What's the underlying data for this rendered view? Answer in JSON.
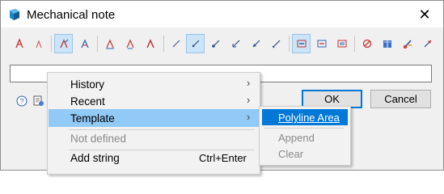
{
  "window": {
    "title": "Mechanical note",
    "close_glyph": "✕",
    "accent": "#0078d7"
  },
  "toolbar": {
    "buttons": [
      {
        "icon": "text-pen-icon",
        "active": false
      },
      {
        "icon": "text-pen-small-icon",
        "active": false
      },
      {
        "icon": "leader-pen-icon",
        "active": true
      },
      {
        "icon": "text-pen-alt-icon",
        "active": false
      },
      {
        "icon": "align-left-text-icon",
        "active": false
      },
      {
        "icon": "align-center-text-icon",
        "active": false
      },
      {
        "icon": "align-right-text-icon",
        "active": false
      },
      {
        "icon": "line-thin-icon",
        "active": false
      },
      {
        "icon": "line-arrow-icon",
        "active": true
      },
      {
        "icon": "line-dot-icon",
        "active": false
      },
      {
        "icon": "line-angle-icon",
        "active": false
      },
      {
        "icon": "line-arrow-alt-icon",
        "active": false
      },
      {
        "icon": "line-end-icon",
        "active": false
      },
      {
        "icon": "frame-icon",
        "active": true
      },
      {
        "icon": "frame-alt-icon",
        "active": false
      },
      {
        "icon": "frame-stack-icon",
        "active": false
      },
      {
        "icon": "no-symbol-icon",
        "active": false
      },
      {
        "icon": "library-icon",
        "active": false
      },
      {
        "icon": "brush-icon",
        "active": false
      },
      {
        "icon": "checkmark-flag-icon",
        "active": false
      }
    ]
  },
  "field": {
    "value": ""
  },
  "bottom": {
    "help_icon": "help-icon",
    "settings_icon": "settings-icon",
    "ok_label": "OK",
    "cancel_label": "Cancel"
  },
  "menu": {
    "items": [
      {
        "label": "History",
        "arrow": "›"
      },
      {
        "label": "Recent",
        "arrow": "›"
      },
      {
        "label": "Template",
        "arrow": "›"
      },
      {
        "label": "Not defined"
      },
      {
        "label": "Add string",
        "shortcut": "Ctrl+Enter"
      }
    ]
  },
  "submenu": {
    "items": [
      {
        "label": "Polyline Area"
      },
      {
        "label": "Append"
      },
      {
        "label": "Clear"
      }
    ]
  }
}
